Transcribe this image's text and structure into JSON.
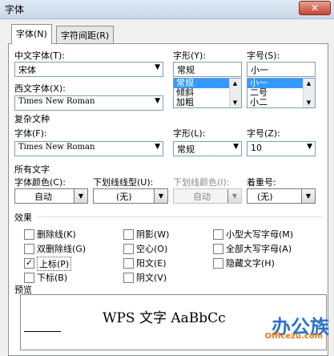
{
  "window": {
    "title": "字体",
    "close_glyph": "✕"
  },
  "tabs": [
    {
      "label": "字体(N)",
      "active": true
    },
    {
      "label": "字符间距(R)",
      "active": false
    }
  ],
  "chinese_font": {
    "label": "中文字体(T):",
    "value": "宋体"
  },
  "western_font": {
    "label": "西文字体(X):",
    "value": "Times New Roman"
  },
  "style": {
    "label": "字形(Y):",
    "value": "常规",
    "options": [
      "常规",
      "倾斜",
      "加粗"
    ],
    "selected": 0
  },
  "size": {
    "label": "字号(S):",
    "value": "小一",
    "options": [
      "小一",
      "二号",
      "小二"
    ],
    "selected": 0
  },
  "complex": {
    "section": "复杂文种",
    "font_label": "字体(F):",
    "font_value": "Times New Roman",
    "style_label": "字形(L):",
    "style_value": "常规",
    "size_label": "字号(Z):",
    "size_value": "10"
  },
  "all_text": {
    "section": "所有文字",
    "color_label": "字体颜色(C):",
    "color_value": "自动",
    "underline_type_label": "下划线线型(U):",
    "underline_type_value": "(无)",
    "underline_color_label": "下划线颜色(I):",
    "underline_color_value": "自动",
    "emphasis_label": "着重号:",
    "emphasis_value": "(无)"
  },
  "effects": {
    "section": "效果",
    "items": [
      {
        "label": "删除线(K)",
        "checked": false
      },
      {
        "label": "双删除线(G)",
        "checked": false
      },
      {
        "label": "上标(P)",
        "checked": true
      },
      {
        "label": "下标(B)",
        "checked": false
      },
      {
        "label": "阴影(W)",
        "checked": false
      },
      {
        "label": "空心(O)",
        "checked": false
      },
      {
        "label": "阳文(E)",
        "checked": false
      },
      {
        "label": "阴文(V)",
        "checked": false
      },
      {
        "label": "小型大写字母(M)",
        "checked": false
      },
      {
        "label": "全部大写字母(A)",
        "checked": false
      },
      {
        "label": "隐藏文字(H)",
        "checked": false
      }
    ]
  },
  "preview": {
    "section": "预览",
    "text": "WPS 文字 AaBbCc"
  },
  "watermark": {
    "main": "办公族",
    "sub": "Officezu.com"
  },
  "check_glyph": "✓"
}
